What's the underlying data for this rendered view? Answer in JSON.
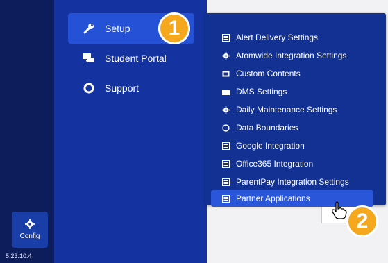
{
  "rail": {
    "config_label": "Config",
    "config_icon": "gear-icon",
    "version": "5.23.10.4"
  },
  "nav": {
    "items": [
      {
        "label": "Setup",
        "icon": "wrench-icon",
        "active": true
      },
      {
        "label": "Student Portal",
        "icon": "chat-icon",
        "active": false
      },
      {
        "label": "Support",
        "icon": "ring-icon",
        "active": false
      }
    ]
  },
  "submenu": {
    "items": [
      {
        "label": "Alert Delivery Settings",
        "icon": "document-icon"
      },
      {
        "label": "Atomwide Integration Settings",
        "icon": "gear-icon"
      },
      {
        "label": "Custom Contents",
        "icon": "document-icon"
      },
      {
        "label": "DMS Settings",
        "icon": "folder-icon"
      },
      {
        "label": "Daily Maintenance Settings",
        "icon": "gear-icon"
      },
      {
        "label": "Data Boundaries",
        "icon": "circle-icon"
      },
      {
        "label": "Google Integration",
        "icon": "document-icon"
      },
      {
        "label": "Office365 Integration",
        "icon": "document-icon"
      },
      {
        "label": "ParentPay Integration Settings",
        "icon": "document-icon"
      },
      {
        "label": "Partner Applications",
        "icon": "document-icon",
        "highlighted": true
      }
    ]
  },
  "callouts": {
    "one": "1",
    "two": "2"
  },
  "colors": {
    "rail": "#0d1d5c",
    "nav": "#1433a0",
    "active": "#2451d6",
    "submenu": "#123193",
    "badge": "#f5a81d"
  }
}
